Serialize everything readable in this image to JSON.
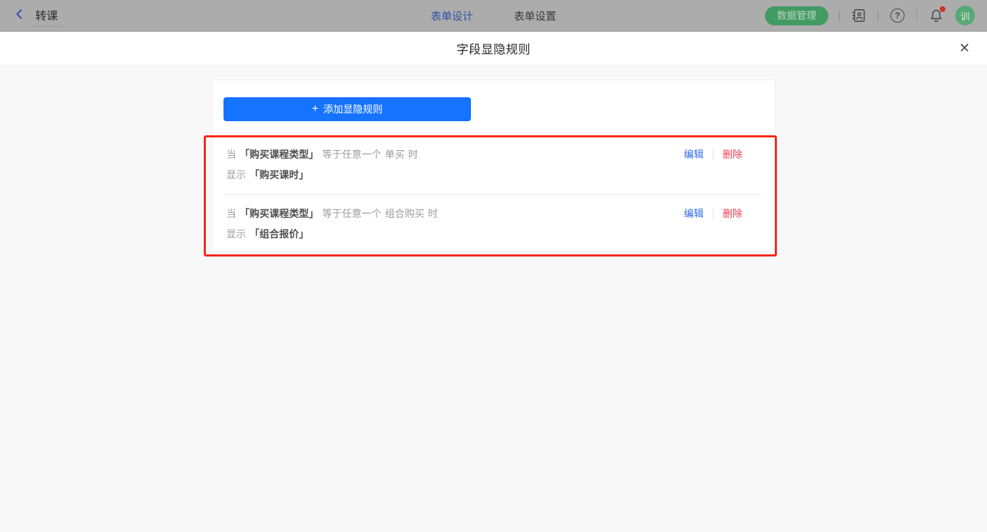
{
  "topbar": {
    "back_label": "转课",
    "tabs": [
      {
        "label": "表单设计",
        "active": true
      },
      {
        "label": "表单设置",
        "active": false
      }
    ],
    "data_manage_label": "数据管理",
    "help_glyph": "?",
    "avatar_text": "训"
  },
  "icons": {
    "back": "chevron-left",
    "contacts": "address-book",
    "help": "question-circle",
    "notifications": "bell-with-red-dot",
    "close": "✕",
    "plus": "+"
  },
  "modal": {
    "title": "字段显隐规则",
    "close_glyph": "✕",
    "add_button": {
      "plus": "+",
      "label": "添加显隐规则"
    },
    "rules": [
      {
        "when_prefix": "当",
        "field": "「购买课程类型」",
        "condition": "等于任意一个",
        "value": "单买",
        "when_suffix": "时",
        "show_prefix": "显示",
        "show_field": "「购买课时」",
        "edit_label": "编辑",
        "delete_label": "删除"
      },
      {
        "when_prefix": "当",
        "field": "「购买课程类型」",
        "condition": "等于任意一个",
        "value": "组合购买",
        "when_suffix": "时",
        "show_prefix": "显示",
        "show_field": "「组合报价」",
        "edit_label": "编辑",
        "delete_label": "删除"
      }
    ]
  },
  "colors": {
    "primary_blue": "#1673ff",
    "edit_link_blue": "#2f6be4",
    "delete_red": "#f23c4f",
    "annotation_red": "#f92613",
    "topbar_bg_dimmed": "#acacac",
    "green_button_dimmed": "#419b63",
    "avatar_green_dimmed": "#57a973",
    "body_bg": "#f8f8f9"
  }
}
